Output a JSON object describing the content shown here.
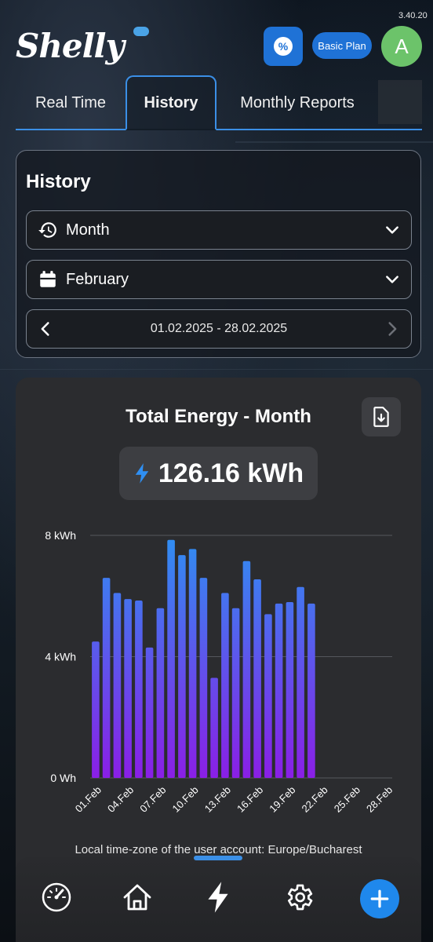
{
  "app": {
    "version": "3.40.20",
    "logo_text": "Shelly",
    "plan_label": "Basic Plan",
    "avatar_initial": "A",
    "promo_icon": "percent-badge-icon"
  },
  "tabs": [
    {
      "label": "Real Time",
      "active": false
    },
    {
      "label": "History",
      "active": true
    },
    {
      "label": "Monthly Reports",
      "active": false
    }
  ],
  "history": {
    "title": "History",
    "period_select": {
      "value": "Month",
      "icon": "history-icon"
    },
    "month_select": {
      "value": "February",
      "icon": "calendar-icon"
    },
    "date_range": "01.02.2025 - 28.02.2025"
  },
  "chart_panel": {
    "title": "Total Energy - Month",
    "total": "126.16 kWh",
    "timezone_note": "Local time-zone of the user account: Europe/Bucharest"
  },
  "chart_data": {
    "type": "bar",
    "xlabel": "",
    "ylabel": "",
    "y_unit": "kWh",
    "ylim": [
      0,
      8
    ],
    "y_ticks": [
      {
        "value": 0,
        "label": "0 Wh"
      },
      {
        "value": 4,
        "label": "4 kWh"
      },
      {
        "value": 8,
        "label": "8 kWh"
      }
    ],
    "categories": [
      "01.Feb",
      "02.Feb",
      "03.Feb",
      "04.Feb",
      "05.Feb",
      "06.Feb",
      "07.Feb",
      "08.Feb",
      "09.Feb",
      "10.Feb",
      "11.Feb",
      "12.Feb",
      "13.Feb",
      "14.Feb",
      "15.Feb",
      "16.Feb",
      "17.Feb",
      "18.Feb",
      "19.Feb",
      "20.Feb",
      "21.Feb",
      "22.Feb",
      "23.Feb",
      "24.Feb",
      "25.Feb",
      "26.Feb",
      "27.Feb",
      "28.Feb"
    ],
    "x_tick_labels": [
      "01.Feb",
      "04.Feb",
      "07.Feb",
      "10.Feb",
      "13.Feb",
      "16.Feb",
      "19.Feb",
      "22.Feb",
      "25.Feb",
      "28.Feb"
    ],
    "values": [
      4.5,
      6.6,
      6.1,
      5.9,
      5.85,
      4.3,
      5.6,
      7.85,
      7.35,
      7.55,
      6.6,
      3.3,
      6.1,
      5.6,
      7.15,
      6.55,
      5.4,
      5.75,
      5.8,
      6.3,
      5.75,
      null,
      null,
      null,
      null,
      null,
      null,
      null
    ],
    "bar_gradient": [
      "#2f8ff2",
      "#8a1fe6"
    ],
    "grid": true
  },
  "bottom_nav": [
    {
      "icon": "dashboard-gauge-icon"
    },
    {
      "icon": "home-icon"
    },
    {
      "icon": "energy-bolt-icon"
    },
    {
      "icon": "settings-gear-icon"
    },
    {
      "icon": "add-plus-icon"
    }
  ]
}
